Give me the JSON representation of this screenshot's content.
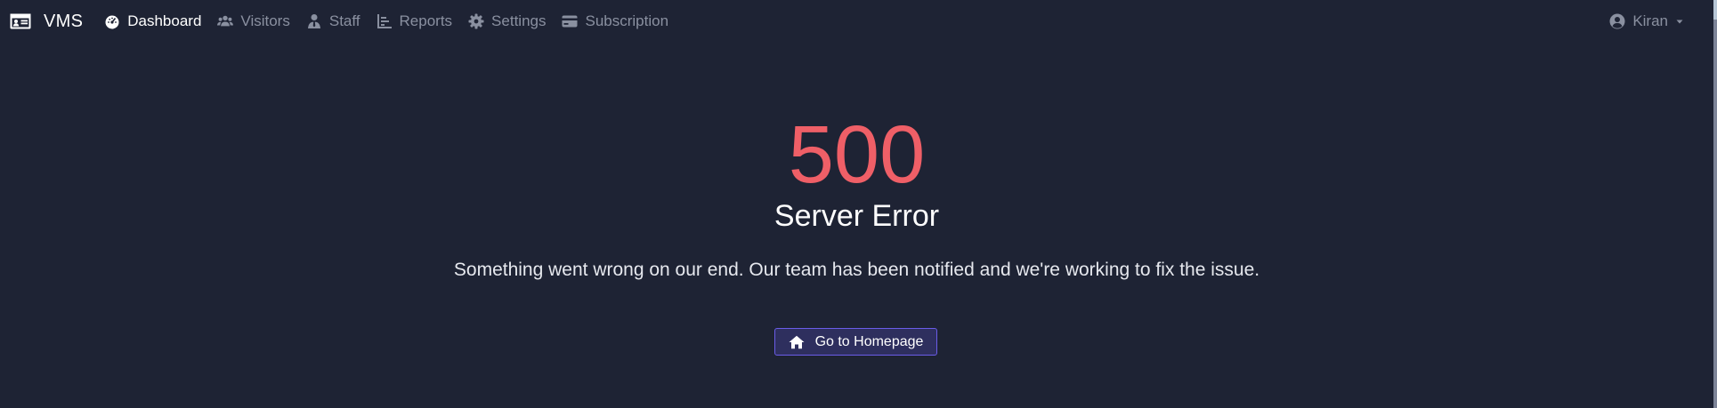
{
  "navbar": {
    "brand": "VMS",
    "items": [
      {
        "label": "Dashboard",
        "icon": "gauge-icon",
        "active": true
      },
      {
        "label": "Visitors",
        "icon": "users-icon",
        "active": false
      },
      {
        "label": "Staff",
        "icon": "user-tie-icon",
        "active": false
      },
      {
        "label": "Reports",
        "icon": "chart-icon",
        "active": false
      },
      {
        "label": "Settings",
        "icon": "gear-icon",
        "active": false
      },
      {
        "label": "Subscription",
        "icon": "credit-card-icon",
        "active": false
      }
    ],
    "user": {
      "name": "Kiran",
      "icon": "user-circle-icon"
    }
  },
  "error": {
    "code": "500",
    "title": "Server Error",
    "message": "Something went wrong on our end. Our team has been notified and we're working to fix the issue.",
    "button_label": "Go to Homepage",
    "button_icon": "home-icon"
  },
  "colors": {
    "background": "#1e2334",
    "error_code": "#ef5f67",
    "nav_inactive": "#8a90a0",
    "button_border": "#6a5ce8",
    "button_bg": "#2e2f5e"
  }
}
